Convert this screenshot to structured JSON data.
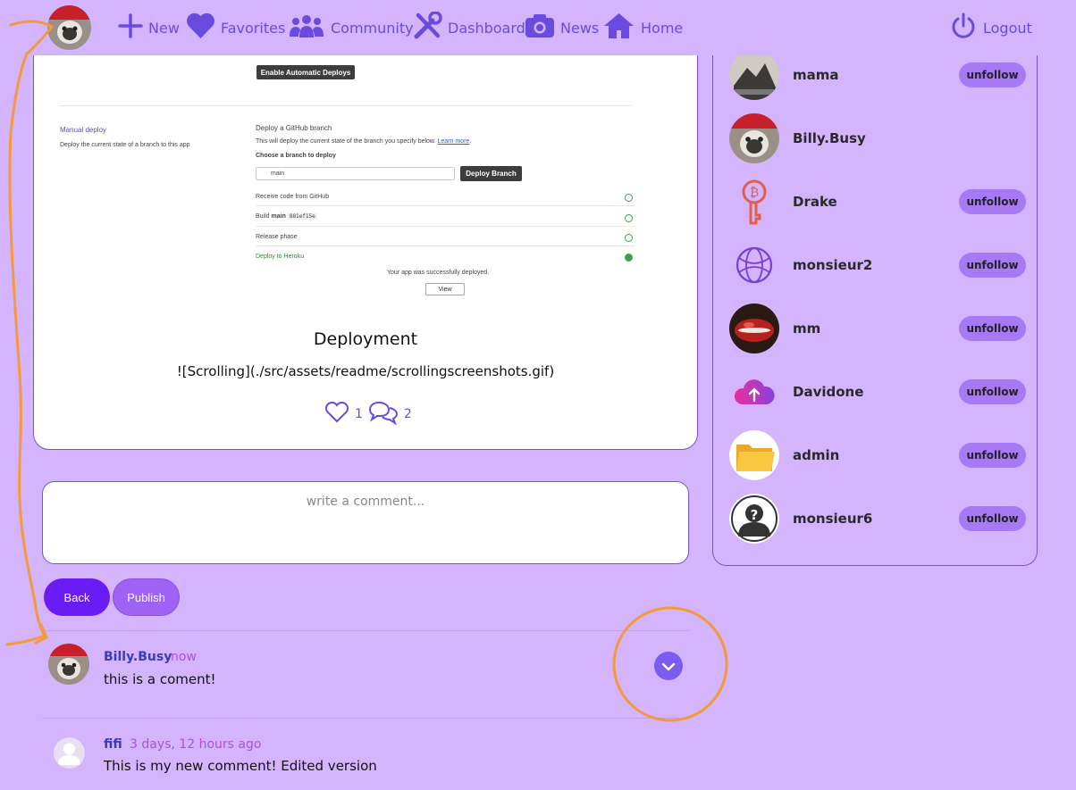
{
  "navbar": {
    "items": [
      {
        "label": "New",
        "icon": "plus-icon"
      },
      {
        "label": "Favorites",
        "icon": "heart-icon"
      },
      {
        "label": "Community",
        "icon": "users-icon"
      },
      {
        "label": "Dashboard",
        "icon": "tools-icon"
      },
      {
        "label": "News",
        "icon": "camera-icon"
      },
      {
        "label": "Home",
        "icon": "home-icon"
      }
    ],
    "logout": "Logout"
  },
  "post": {
    "screenshot": {
      "enable_auto": "Enable Automatic Deploys",
      "manual_deploy": "Manual deploy",
      "manual_desc": "Deploy the current state of a branch to this app",
      "deploy_github": "Deploy a GitHub branch",
      "deploy_desc": "This will deploy the current state of the branch you specify below.",
      "learn_more": "Learn more",
      "choose_branch": "Choose a branch to deploy",
      "branch": "main",
      "deploy_branch": "Deploy Branch",
      "step1": "Receive code from GitHub",
      "step2a": "Build",
      "step2b": "main",
      "step2c": "881ef15e",
      "step3": "Release phase",
      "step4": "Deploy to Heroku",
      "success": "Your app was successfully deployed.",
      "view": "View"
    },
    "title": "Deployment",
    "body": "![Scrolling](./src/assets/readme/scrollingscreenshots.gif)",
    "likes": "1",
    "comments": "2"
  },
  "comment_form": {
    "placeholder": "write a comment...",
    "back": "Back",
    "publish": "Publish"
  },
  "comments": [
    {
      "user": "Billy.Busy",
      "time": "now",
      "text": "this is a coment!"
    },
    {
      "user": "fifi",
      "time": "3 days, 12 hours ago",
      "text": "This is my new comment! Edited version"
    }
  ],
  "following": [
    {
      "name": "mama",
      "button": "unfollow"
    },
    {
      "name": "Billy.Busy",
      "button": ""
    },
    {
      "name": "Drake",
      "button": "unfollow"
    },
    {
      "name": "monsieur2",
      "button": "unfollow"
    },
    {
      "name": "mm",
      "button": "unfollow"
    },
    {
      "name": "Davidone",
      "button": "unfollow"
    },
    {
      "name": "admin",
      "button": "unfollow"
    },
    {
      "name": "monsieur6",
      "button": "unfollow"
    }
  ],
  "colors": {
    "background": "#d4b4fc",
    "accent": "#6a4be0",
    "primary_button": "#6a1cf5",
    "secondary_button": "#9e63f5",
    "annotation": "#f39a3c"
  }
}
